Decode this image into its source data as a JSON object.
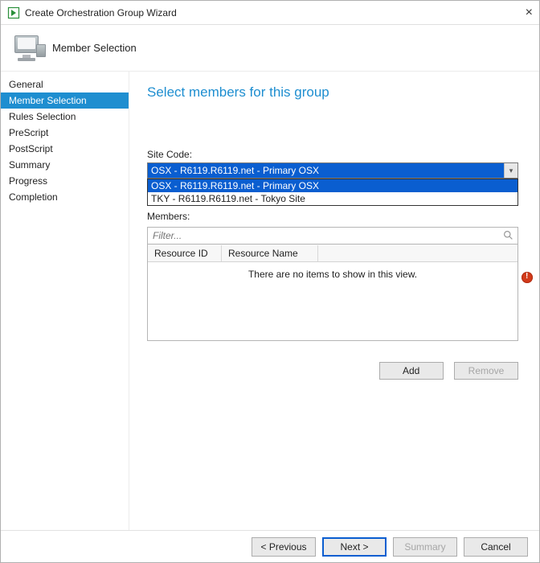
{
  "window": {
    "title": "Create Orchestration Group Wizard"
  },
  "header": {
    "title": "Member Selection"
  },
  "sidebar": {
    "items": [
      {
        "label": "General",
        "active": false
      },
      {
        "label": "Member Selection",
        "active": true
      },
      {
        "label": "Rules Selection",
        "active": false
      },
      {
        "label": "PreScript",
        "active": false
      },
      {
        "label": "PostScript",
        "active": false
      },
      {
        "label": "Summary",
        "active": false
      },
      {
        "label": "Progress",
        "active": false
      },
      {
        "label": "Completion",
        "active": false
      }
    ]
  },
  "main": {
    "heading": "Select members for this group",
    "sitecode": {
      "label": "Site Code:",
      "value": "OSX - R6119.R6119.net - Primary OSX",
      "options": [
        "OSX - R6119.R6119.net - Primary OSX",
        "TKY - R6119.R6119.net - Tokyo Site"
      ]
    },
    "members": {
      "label": "Members:",
      "filter_placeholder": "Filter...",
      "columns": [
        "Resource ID",
        "Resource Name"
      ],
      "empty": "There are no items to show in this view."
    },
    "buttons": {
      "add": "Add",
      "remove": "Remove"
    }
  },
  "footer": {
    "previous": "< Previous",
    "next": "Next >",
    "summary": "Summary",
    "cancel": "Cancel"
  }
}
